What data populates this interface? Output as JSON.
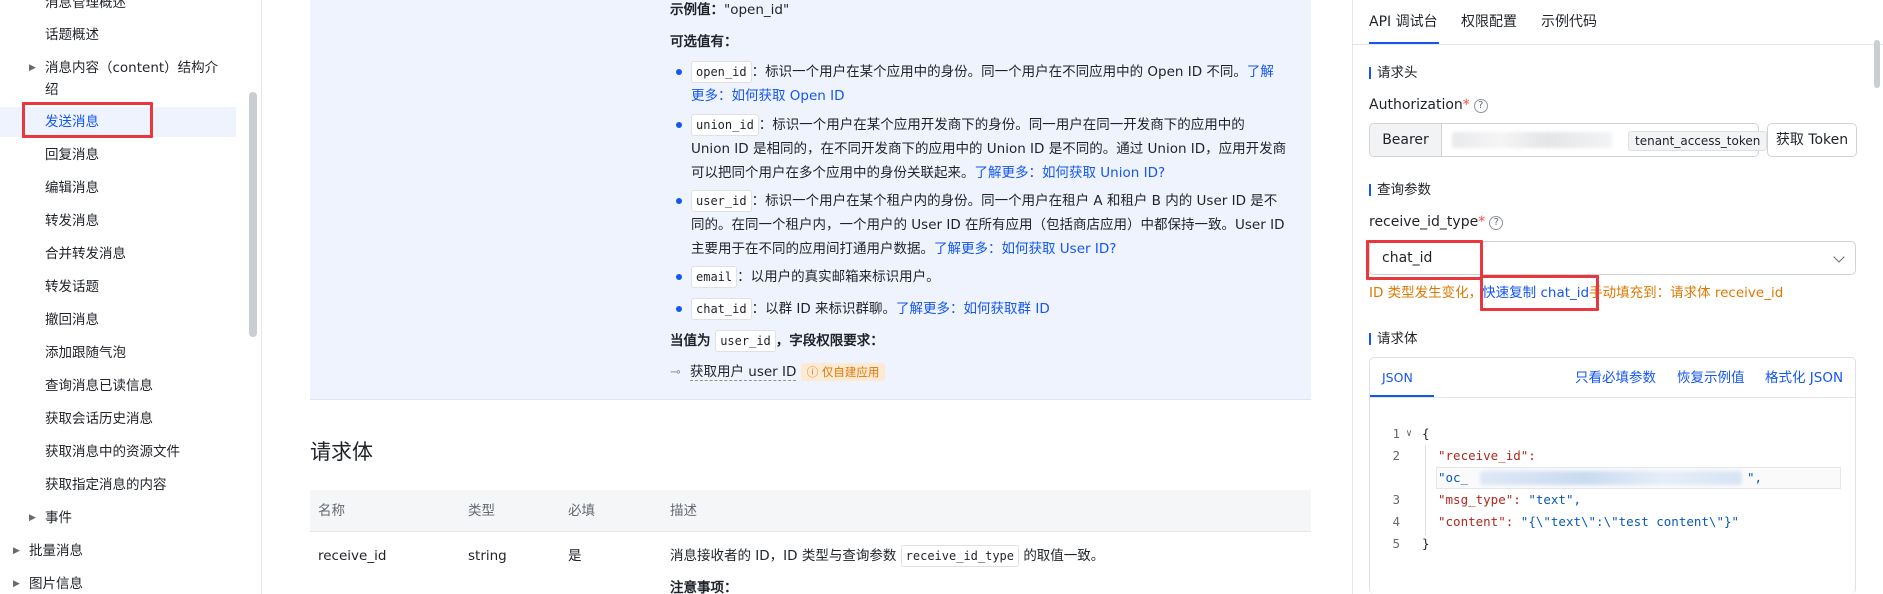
{
  "sidebar": {
    "items": [
      {
        "label": "消息管理概述",
        "indent": 2
      },
      {
        "label": "话题概述",
        "indent": 2
      },
      {
        "label": "消息内容（content）结构介",
        "label2": "绍",
        "indent": 2,
        "caret": true
      },
      {
        "label": "发送消息",
        "indent": 2,
        "active": true
      },
      {
        "label": "回复消息",
        "indent": 2
      },
      {
        "label": "编辑消息",
        "indent": 2
      },
      {
        "label": "转发消息",
        "indent": 2
      },
      {
        "label": "合并转发消息",
        "indent": 2
      },
      {
        "label": "转发话题",
        "indent": 2
      },
      {
        "label": "撤回消息",
        "indent": 2
      },
      {
        "label": "添加跟随气泡",
        "indent": 2
      },
      {
        "label": "查询消息已读信息",
        "indent": 2
      },
      {
        "label": "获取会话历史消息",
        "indent": 2
      },
      {
        "label": "获取消息中的资源文件",
        "indent": 2
      },
      {
        "label": "获取指定消息的内容",
        "indent": 2
      },
      {
        "label": "事件",
        "indent": 1,
        "caret": true
      },
      {
        "label": "批量消息",
        "indent": 0,
        "caret": true
      },
      {
        "label": "图片信息",
        "indent": 0,
        "caret": true
      }
    ]
  },
  "doc": {
    "example_label": "示例值：",
    "example_value": "\"open_id\"",
    "optional_title": "可选值有：",
    "options": [
      {
        "code": "open_id",
        "lines": [
          "：标识一个用户在某个应用中的身份。同一个用户在不同应用中的 Open ID 不同。",
          "多：如何获取 Open ID"
        ],
        "link_tail1": "了解",
        "link_prefix2": "更"
      },
      {
        "code": "union_id",
        "lines": [
          "：标识一个用户在某个应用开发商下的身份。同一用户在同一开发商下的应用中的",
          "Union ID 是相同的，在不同开发商下的应用中的 Union ID 是不同的。通过 Union ID，应用开发商",
          "可以把同个用户在多个应用中的身份关联起来。"
        ],
        "link": "了解更多：如何获取 Union ID?"
      },
      {
        "code": "user_id",
        "lines": [
          "：标识一个用户在某个租户内的身份。同一个用户在租户 A 和租户 B 内的 User ID 是不",
          "同的。在同一个租户内，一个用户的 User ID 在所有应用（包括商店应用）中都保持一致。User ID",
          "主要用于在不同的应用间打通用户数据。"
        ],
        "link": "了解更多：如何获取 User ID?"
      },
      {
        "code": "email",
        "lines": [
          "：以用户的真实邮箱来标识用户。"
        ]
      },
      {
        "code": "chat_id",
        "lines": [
          "：以群 ID 来标识群聊。"
        ],
        "link": "了解更多：如何获取群 ID"
      }
    ],
    "perm_prefix": "当值为",
    "perm_code": "user_id",
    "perm_suffix": "，字段权限要求：",
    "perm_item": "获取用户 user ID",
    "perm_tag": "仅自建应用",
    "section_title": "请求体",
    "table_headers": [
      "名称",
      "类型",
      "必填",
      "描述"
    ],
    "row": {
      "name": "receive_id",
      "type": "string",
      "required": "是",
      "desc_prefix": "消息接收者的 ID，ID 类型与查询参数",
      "desc_code": "receive_id_type",
      "desc_suffix": "的取值一致。",
      "note": "注意事项："
    }
  },
  "api_panel": {
    "tabs": [
      "API 调试台",
      "权限配置",
      "示例代码"
    ],
    "active_tab": 0,
    "header_section": "请求头",
    "auth_label": "Authorization",
    "auth_prefix": "Bearer",
    "token_tag": "tenant_access_token",
    "get_token_btn": "获取 Token",
    "query_section": "查询参数",
    "receive_id_type_label": "receive_id_type",
    "receive_id_type_value": "chat_id",
    "warn_prefix": "ID 类型发生变化，",
    "warn_link": "快速复制 chat_id",
    "warn_suffix": "手动填充到：请求体 receive_id",
    "body_section": "请求体",
    "json_tab": "JSON",
    "json_actions": [
      "只看必填参数",
      "恢复示例值",
      "格式化 JSON"
    ],
    "code": {
      "l1": "{",
      "l2_key": "\"receive_id\":",
      "l2_val_prefix": "\"oc_",
      "l2_val_suffix": "\",",
      "l3_key": "\"msg_type\":",
      "l3_val": " \"text\",",
      "l4_key": "\"content\":",
      "l4_val": " \"{\\\"text\\\":\\\"test content\\\"}\"",
      "l5": "}"
    },
    "line_numbers": [
      "1",
      "2",
      "3",
      "4",
      "5"
    ]
  },
  "colors": {
    "accent": "#1456f0",
    "highlight_red": "#e8383d",
    "warning": "#de7802"
  }
}
